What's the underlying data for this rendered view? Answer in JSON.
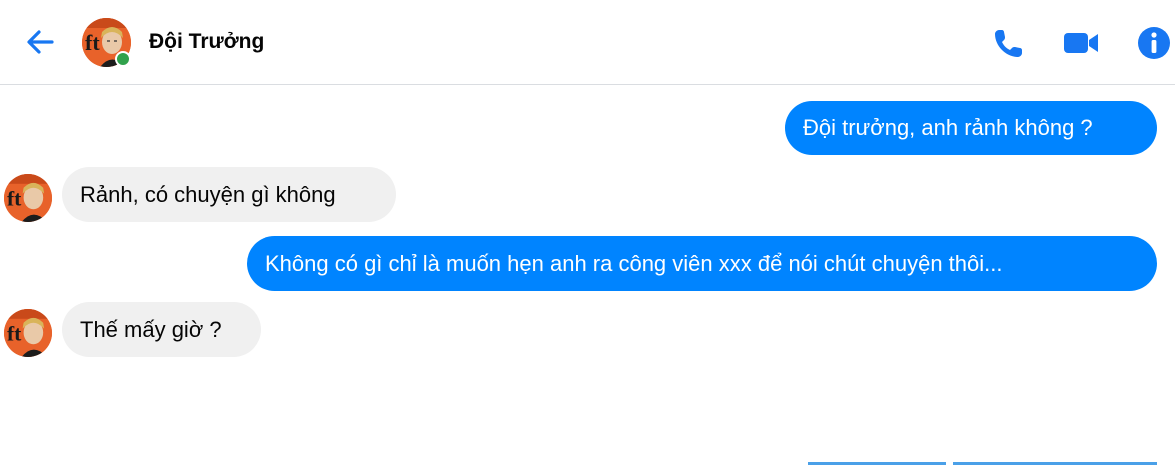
{
  "header": {
    "contact_name": "Đội Trưởng",
    "online": true,
    "icons": [
      "back-arrow-icon",
      "phone-icon",
      "video-camera-icon",
      "info-icon"
    ]
  },
  "messages": [
    {
      "direction": "outgoing",
      "text": "Đội trưởng, anh rảnh không ?"
    },
    {
      "direction": "incoming",
      "text": "Rảnh, có chuyện gì không"
    },
    {
      "direction": "outgoing",
      "text": "Không có gì chỉ là muốn hẹn anh ra công viên xxx để nói chút chuyện thôi..."
    },
    {
      "direction": "incoming",
      "text": "Thế mấy giờ ?"
    }
  ],
  "colors": {
    "accent": "#0084ff",
    "incoming_bubble": "#f0f0f0",
    "online": "#31a24c",
    "icon": "#1877f2"
  }
}
